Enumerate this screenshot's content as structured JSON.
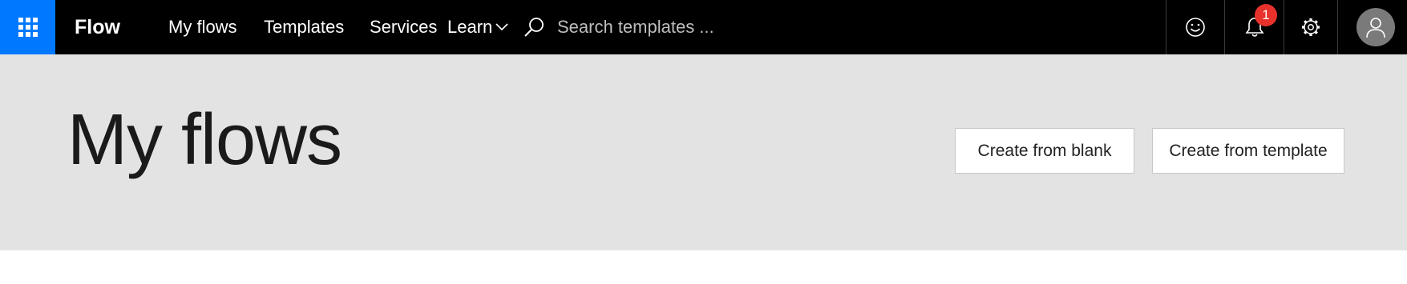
{
  "app": {
    "name": "Flow"
  },
  "nav": [
    {
      "label": "My flows"
    },
    {
      "label": "Templates"
    },
    {
      "label": "Services"
    },
    {
      "label": "Learn"
    }
  ],
  "search": {
    "placeholder": "Search templates ..."
  },
  "notifications": {
    "count": "1"
  },
  "icons": [
    "app-launcher-icon",
    "chevron-down-icon",
    "search-icon",
    "smiley-icon",
    "bell-icon",
    "gear-icon",
    "user-icon"
  ],
  "colors": {
    "topbar": "#000000",
    "launcher": "#0078ff",
    "badge": "#e8312b",
    "hero": "#e3e3e3"
  },
  "hero": {
    "title": "My flows",
    "buttons": {
      "blank": "Create from blank",
      "template": "Create from template"
    }
  }
}
